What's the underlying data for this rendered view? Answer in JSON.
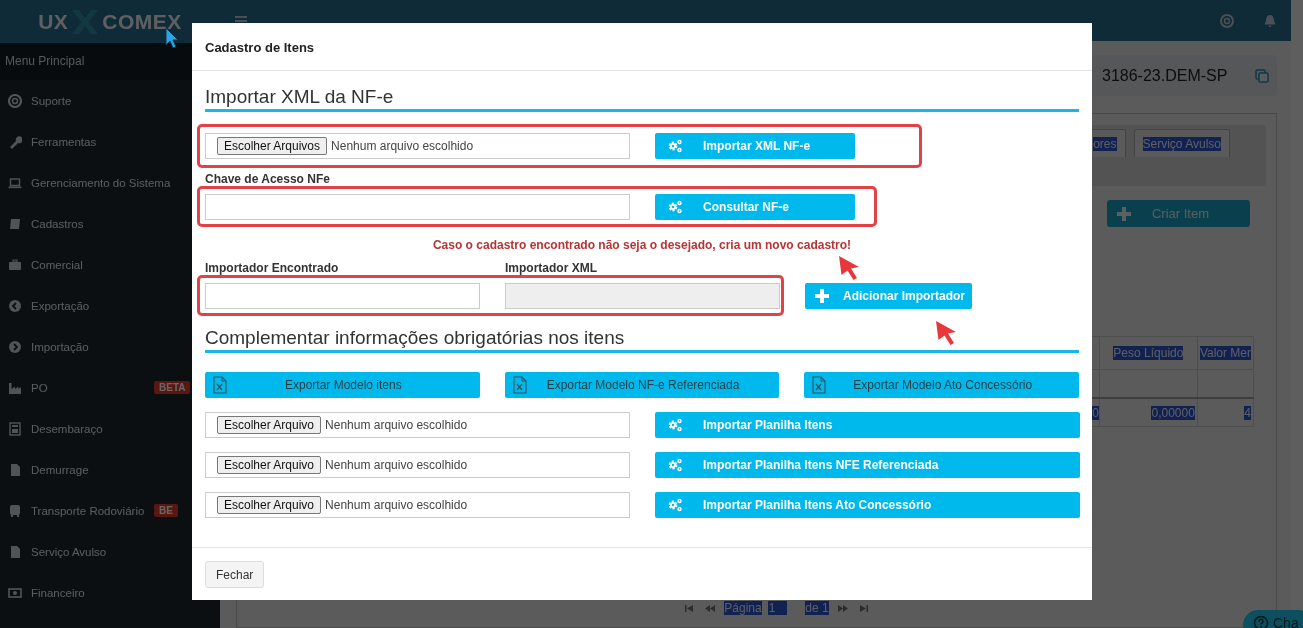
{
  "sidebar": {
    "logo": {
      "left": "UX",
      "right": "COMEX"
    },
    "menu_title": "Menu Principal",
    "items": [
      {
        "label": "Suporte"
      },
      {
        "label": "Ferramentas"
      },
      {
        "label": "Gerenciamento do Sistema"
      },
      {
        "label": "Cadastros"
      },
      {
        "label": "Comercial"
      },
      {
        "label": "Exportação"
      },
      {
        "label": "Importação"
      },
      {
        "label": "PO",
        "badge": "BETA"
      },
      {
        "label": "Desembaraço"
      },
      {
        "label": "Demurrage"
      },
      {
        "label": "Transporte Rodoviário",
        "badge": "BE"
      },
      {
        "label": "Serviço Avulso"
      },
      {
        "label": "Financeiro"
      }
    ]
  },
  "header": {
    "process_code": "3186-23.DEM-SP"
  },
  "tabs": [
    {
      "label": "ores",
      "selected": false
    },
    {
      "label": "Serviço Avulso",
      "selected": false
    }
  ],
  "create_button": "Criar Item",
  "table": {
    "columns": [
      "",
      "Peso Líquido",
      "Valor Mer"
    ],
    "rows": [
      {
        "cells": [
          "0",
          "0,00000",
          "4"
        ]
      }
    ]
  },
  "pagination": {
    "label": "Página",
    "page": "1",
    "total": "de 1"
  },
  "chat": {
    "label": "Cha"
  },
  "modal": {
    "title": "Cadastro de Itens",
    "xml_section": {
      "heading": "Importar XML da NF-e",
      "file_input": {
        "button": "Escolher Arquivos",
        "status": "Nenhum arquivo escolhido"
      },
      "import_button": "Importar XML NF-e",
      "access_key": {
        "label": "Chave de Acesso NFe"
      },
      "consult_button": "Consultar NF-e",
      "note": "Caso o cadastro encontrado não seja o desejado, cria um novo cadastro!",
      "found_importer": {
        "label": "Importador Encontrado",
        "disabled": false
      },
      "xml_importer": {
        "label": "Importador XML",
        "disabled": true
      },
      "add_button": "Adicionar Importador"
    },
    "complement_section": {
      "heading": "Complementar informações obrigatórias nos itens",
      "export_buttons": [
        "Exportar Modelo itens",
        "Exportar Modelo NF-e Referenciada",
        "Exportar Modelo Ato Concessório"
      ],
      "imports": [
        {
          "file_button": "Escolher Arquivo",
          "file_status": "Nenhum arquivo escolhido",
          "import_button": "Importar Planilha Itens"
        },
        {
          "file_button": "Escolher Arquivo",
          "file_status": "Nenhum arquivo escolhido",
          "import_button": "Importar Planilha Itens NFE Referenciada"
        },
        {
          "file_button": "Escolher Arquivo",
          "file_status": "Nenhum arquivo escolhido",
          "import_button": "Importar Planilha Itens Ato Concessório"
        }
      ]
    },
    "close_button": "Fechar"
  }
}
